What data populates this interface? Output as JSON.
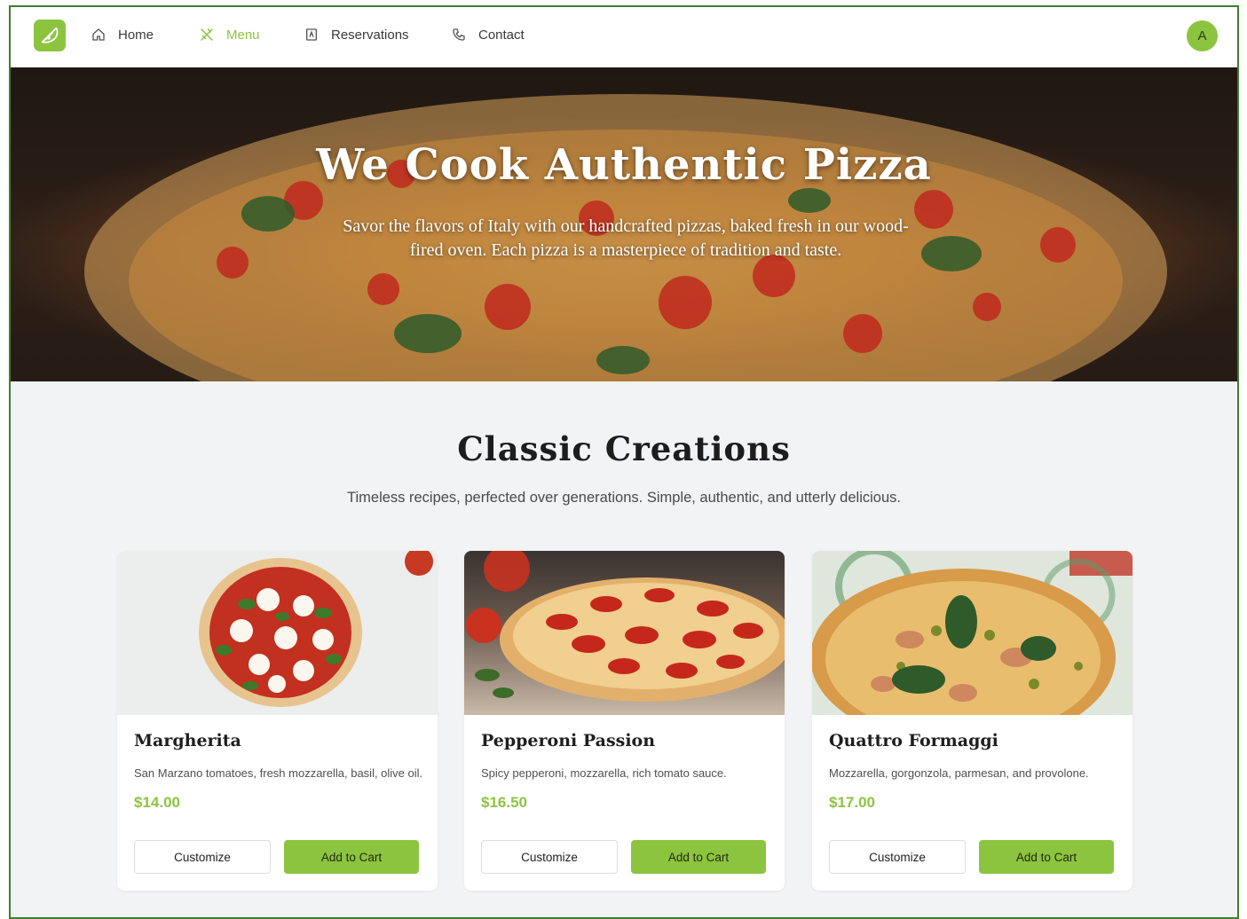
{
  "nav": {
    "items": [
      {
        "label": "Home",
        "icon": "home-icon",
        "active": false
      },
      {
        "label": "Menu",
        "icon": "utensils-icon",
        "active": true
      },
      {
        "label": "Reservations",
        "icon": "book-icon",
        "active": false
      },
      {
        "label": "Contact",
        "icon": "phone-icon",
        "active": false
      }
    ],
    "avatar_initial": "A"
  },
  "hero": {
    "title": "We Cook Authentic Pizza",
    "subtitle": "Savor the flavors of Italy with our handcrafted pizzas, baked fresh in our wood-fired oven. Each pizza is a masterpiece of tradition and taste."
  },
  "section": {
    "title": "Classic Creations",
    "subtitle": "Timeless recipes, perfected over generations. Simple, authentic, and utterly delicious."
  },
  "cards": [
    {
      "name": "Margherita",
      "description": "San Marzano tomatoes, fresh mozzarella, basil, olive oil.",
      "price": "$14.00",
      "customize_label": "Customize",
      "cart_label": "Add to Cart"
    },
    {
      "name": "Pepperoni Passion",
      "description": "Spicy pepperoni, mozzarella, rich tomato sauce.",
      "price": "$16.50",
      "customize_label": "Customize",
      "cart_label": "Add to Cart"
    },
    {
      "name": "Quattro Formaggi",
      "description": "Mozzarella, gorgonzola, parmesan, and provolone.",
      "price": "$17.00",
      "customize_label": "Customize",
      "cart_label": "Add to Cart"
    }
  ],
  "colors": {
    "accent": "#8cc43f",
    "frame_border": "#3f7d2e",
    "background": "#f2f3f5"
  }
}
